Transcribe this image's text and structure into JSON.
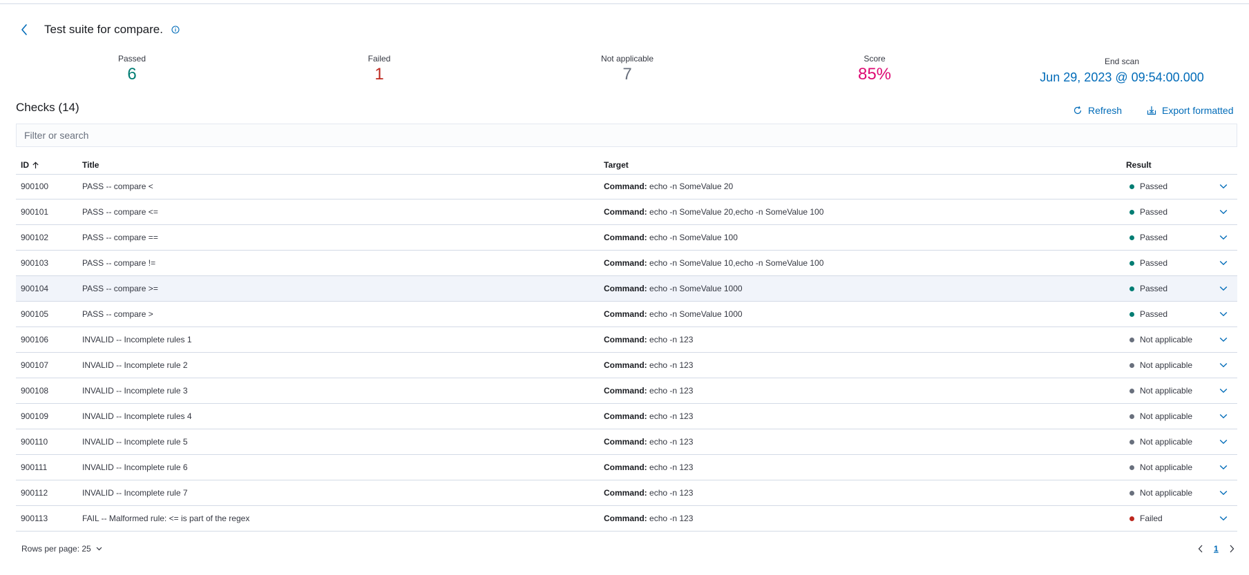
{
  "header": {
    "title": "Test suite for compare.",
    "back_icon": "chevron-left-icon",
    "info_icon": "info-circle-icon"
  },
  "stats": [
    {
      "label": "Passed",
      "value": "6",
      "color": "#017d73"
    },
    {
      "label": "Failed",
      "value": "1",
      "color": "#bd271e"
    },
    {
      "label": "Not applicable",
      "value": "7",
      "color": "#69707d"
    },
    {
      "label": "Score",
      "value": "85%",
      "color": "#dd0a73"
    },
    {
      "label": "End scan",
      "value": "Jun 29, 2023 @ 09:54:00.000",
      "color": "#006bb8"
    }
  ],
  "checks": {
    "title": "Checks (14)",
    "refresh_label": "Refresh",
    "export_label": "Export formatted",
    "search_placeholder": "Filter or search"
  },
  "table": {
    "columns": {
      "id": "ID",
      "title": "Title",
      "target": "Target",
      "result": "Result"
    },
    "sort_icon": "arrow-up-icon",
    "rows": [
      {
        "id": "900100",
        "title": "PASS -- compare <",
        "target_label": "Command:",
        "target_value": "echo -n SomeValue 20",
        "result": "Passed"
      },
      {
        "id": "900101",
        "title": "PASS -- compare <=",
        "target_label": "Command:",
        "target_value": "echo -n SomeValue 20,echo -n SomeValue 100",
        "result": "Passed"
      },
      {
        "id": "900102",
        "title": "PASS -- compare ==",
        "target_label": "Command:",
        "target_value": "echo -n SomeValue 100",
        "result": "Passed"
      },
      {
        "id": "900103",
        "title": "PASS -- compare !=",
        "target_label": "Command:",
        "target_value": "echo -n SomeValue 10,echo -n SomeValue 100",
        "result": "Passed"
      },
      {
        "id": "900104",
        "title": "PASS -- compare >=",
        "target_label": "Command:",
        "target_value": "echo -n SomeValue 1000",
        "result": "Passed"
      },
      {
        "id": "900105",
        "title": "PASS -- compare >",
        "target_label": "Command:",
        "target_value": "echo -n SomeValue 1000",
        "result": "Passed"
      },
      {
        "id": "900106",
        "title": "INVALID -- Incomplete rules 1",
        "target_label": "Command:",
        "target_value": "echo -n 123",
        "result": "Not applicable"
      },
      {
        "id": "900107",
        "title": "INVALID -- Incomplete rule 2",
        "target_label": "Command:",
        "target_value": "echo -n 123",
        "result": "Not applicable"
      },
      {
        "id": "900108",
        "title": "INVALID -- Incomplete rule 3",
        "target_label": "Command:",
        "target_value": "echo -n 123",
        "result": "Not applicable"
      },
      {
        "id": "900109",
        "title": "INVALID -- Incomplete rules 4",
        "target_label": "Command:",
        "target_value": "echo -n 123",
        "result": "Not applicable"
      },
      {
        "id": "900110",
        "title": "INVALID -- Incomplete rule 5",
        "target_label": "Command:",
        "target_value": "echo -n 123",
        "result": "Not applicable"
      },
      {
        "id": "900111",
        "title": "INVALID -- Incomplete rule 6",
        "target_label": "Command:",
        "target_value": "echo -n 123",
        "result": "Not applicable"
      },
      {
        "id": "900112",
        "title": "INVALID -- Incomplete rule 7",
        "target_label": "Command:",
        "target_value": "echo -n 123",
        "result": "Not applicable"
      },
      {
        "id": "900113",
        "title": "FAIL -- Malformed rule: <= is part of the regex",
        "target_label": "Command:",
        "target_value": "echo -n 123",
        "result": "Failed"
      }
    ],
    "highlighted_row": "900104"
  },
  "result_colors": {
    "Passed": "#017d73",
    "Not applicable": "#69707d",
    "Failed": "#bd271e"
  },
  "footer": {
    "rows_per_page_label": "Rows per page: 25",
    "current_page": "1"
  },
  "colors": {
    "accent": "#006bb8",
    "border": "#d3dae6"
  }
}
